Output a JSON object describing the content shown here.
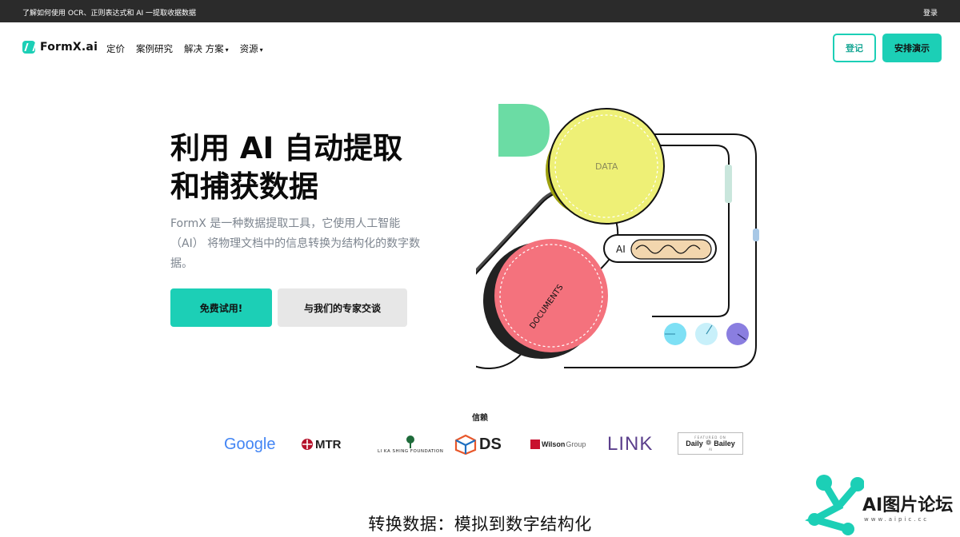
{
  "topbar": {
    "announcement": "了解如何使用 OCR、正则表达式和 AI 一提取收据数据",
    "login": "登录"
  },
  "nav": {
    "logo_text": "FormX.ai",
    "items": [
      {
        "label": "定价"
      },
      {
        "label": "案例研究"
      },
      {
        "label": "解决 方案",
        "dropdown": true
      },
      {
        "label": "资源",
        "dropdown": true
      }
    ],
    "register_button": "登记",
    "demo_button": "安排演示"
  },
  "hero": {
    "title_line1": "利用 AI 自动提取",
    "title_line2": "和捕获数据",
    "description": "FormX 是一种数据提取工具，它使用人工智能（AI） 将物理文档中的信息转换为结构化的数字数据。",
    "primary_cta": "免费试用!",
    "secondary_cta": "与我们的专家交谈"
  },
  "illustration": {
    "data_label": "DATA",
    "documents_label": "DOCUMENTS",
    "ai_label": "AI"
  },
  "trusted": {
    "heading": "信赖",
    "logos": [
      {
        "name": "Google"
      },
      {
        "name": "MTR"
      },
      {
        "name": "LI KA SHING FOUNDATION"
      },
      {
        "name": "DS"
      },
      {
        "name": "Wilson",
        "suffix": "Group"
      },
      {
        "name": "LINK"
      },
      {
        "name": "Daily",
        "name2": "Bailey",
        "featured": "FEATURED ON",
        "sub": "AI"
      }
    ]
  },
  "section": {
    "title": "转换数据：模拟到数字结构化"
  },
  "watermark": {
    "text": "AI图片论坛",
    "sub": "www.aipic.cc"
  },
  "colors": {
    "accent": "#1ccfb6",
    "topbar": "#2b2b2b",
    "data_circle": "#eef076",
    "documents_circle": "#f4727d",
    "green_shape": "#6bdca4"
  }
}
